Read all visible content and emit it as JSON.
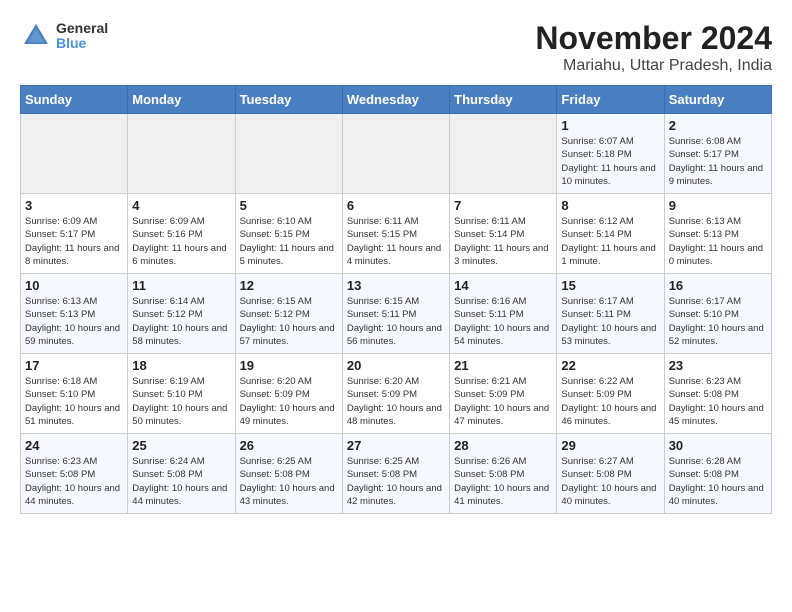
{
  "logo": {
    "general": "General",
    "blue": "Blue"
  },
  "title": "November 2024",
  "location": "Mariahu, Uttar Pradesh, India",
  "days_of_week": [
    "Sunday",
    "Monday",
    "Tuesday",
    "Wednesday",
    "Thursday",
    "Friday",
    "Saturday"
  ],
  "weeks": [
    [
      {
        "day": "",
        "info": ""
      },
      {
        "day": "",
        "info": ""
      },
      {
        "day": "",
        "info": ""
      },
      {
        "day": "",
        "info": ""
      },
      {
        "day": "",
        "info": ""
      },
      {
        "day": "1",
        "info": "Sunrise: 6:07 AM\nSunset: 5:18 PM\nDaylight: 11 hours and 10 minutes."
      },
      {
        "day": "2",
        "info": "Sunrise: 6:08 AM\nSunset: 5:17 PM\nDaylight: 11 hours and 9 minutes."
      }
    ],
    [
      {
        "day": "3",
        "info": "Sunrise: 6:09 AM\nSunset: 5:17 PM\nDaylight: 11 hours and 8 minutes."
      },
      {
        "day": "4",
        "info": "Sunrise: 6:09 AM\nSunset: 5:16 PM\nDaylight: 11 hours and 6 minutes."
      },
      {
        "day": "5",
        "info": "Sunrise: 6:10 AM\nSunset: 5:15 PM\nDaylight: 11 hours and 5 minutes."
      },
      {
        "day": "6",
        "info": "Sunrise: 6:11 AM\nSunset: 5:15 PM\nDaylight: 11 hours and 4 minutes."
      },
      {
        "day": "7",
        "info": "Sunrise: 6:11 AM\nSunset: 5:14 PM\nDaylight: 11 hours and 3 minutes."
      },
      {
        "day": "8",
        "info": "Sunrise: 6:12 AM\nSunset: 5:14 PM\nDaylight: 11 hours and 1 minute."
      },
      {
        "day": "9",
        "info": "Sunrise: 6:13 AM\nSunset: 5:13 PM\nDaylight: 11 hours and 0 minutes."
      }
    ],
    [
      {
        "day": "10",
        "info": "Sunrise: 6:13 AM\nSunset: 5:13 PM\nDaylight: 10 hours and 59 minutes."
      },
      {
        "day": "11",
        "info": "Sunrise: 6:14 AM\nSunset: 5:12 PM\nDaylight: 10 hours and 58 minutes."
      },
      {
        "day": "12",
        "info": "Sunrise: 6:15 AM\nSunset: 5:12 PM\nDaylight: 10 hours and 57 minutes."
      },
      {
        "day": "13",
        "info": "Sunrise: 6:15 AM\nSunset: 5:11 PM\nDaylight: 10 hours and 56 minutes."
      },
      {
        "day": "14",
        "info": "Sunrise: 6:16 AM\nSunset: 5:11 PM\nDaylight: 10 hours and 54 minutes."
      },
      {
        "day": "15",
        "info": "Sunrise: 6:17 AM\nSunset: 5:11 PM\nDaylight: 10 hours and 53 minutes."
      },
      {
        "day": "16",
        "info": "Sunrise: 6:17 AM\nSunset: 5:10 PM\nDaylight: 10 hours and 52 minutes."
      }
    ],
    [
      {
        "day": "17",
        "info": "Sunrise: 6:18 AM\nSunset: 5:10 PM\nDaylight: 10 hours and 51 minutes."
      },
      {
        "day": "18",
        "info": "Sunrise: 6:19 AM\nSunset: 5:10 PM\nDaylight: 10 hours and 50 minutes."
      },
      {
        "day": "19",
        "info": "Sunrise: 6:20 AM\nSunset: 5:09 PM\nDaylight: 10 hours and 49 minutes."
      },
      {
        "day": "20",
        "info": "Sunrise: 6:20 AM\nSunset: 5:09 PM\nDaylight: 10 hours and 48 minutes."
      },
      {
        "day": "21",
        "info": "Sunrise: 6:21 AM\nSunset: 5:09 PM\nDaylight: 10 hours and 47 minutes."
      },
      {
        "day": "22",
        "info": "Sunrise: 6:22 AM\nSunset: 5:09 PM\nDaylight: 10 hours and 46 minutes."
      },
      {
        "day": "23",
        "info": "Sunrise: 6:23 AM\nSunset: 5:08 PM\nDaylight: 10 hours and 45 minutes."
      }
    ],
    [
      {
        "day": "24",
        "info": "Sunrise: 6:23 AM\nSunset: 5:08 PM\nDaylight: 10 hours and 44 minutes."
      },
      {
        "day": "25",
        "info": "Sunrise: 6:24 AM\nSunset: 5:08 PM\nDaylight: 10 hours and 44 minutes."
      },
      {
        "day": "26",
        "info": "Sunrise: 6:25 AM\nSunset: 5:08 PM\nDaylight: 10 hours and 43 minutes."
      },
      {
        "day": "27",
        "info": "Sunrise: 6:25 AM\nSunset: 5:08 PM\nDaylight: 10 hours and 42 minutes."
      },
      {
        "day": "28",
        "info": "Sunrise: 6:26 AM\nSunset: 5:08 PM\nDaylight: 10 hours and 41 minutes."
      },
      {
        "day": "29",
        "info": "Sunrise: 6:27 AM\nSunset: 5:08 PM\nDaylight: 10 hours and 40 minutes."
      },
      {
        "day": "30",
        "info": "Sunrise: 6:28 AM\nSunset: 5:08 PM\nDaylight: 10 hours and 40 minutes."
      }
    ]
  ]
}
